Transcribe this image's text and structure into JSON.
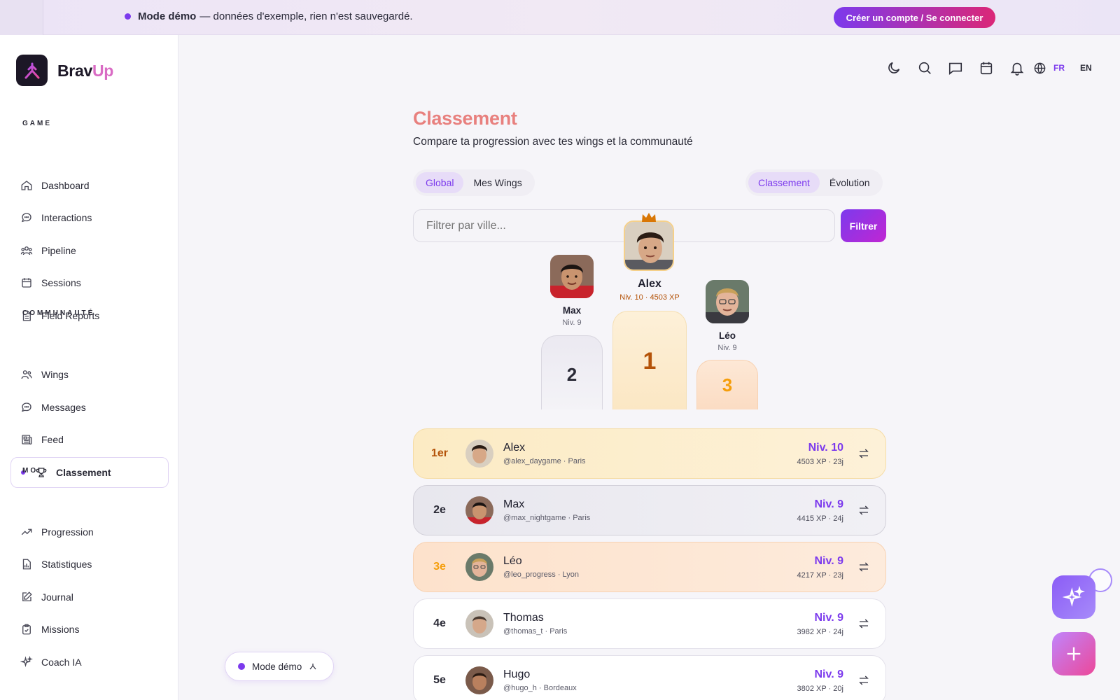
{
  "banner": {
    "mode_label": "Mode démo",
    "message": "— données d'exemple, rien n'est sauvegardé.",
    "cta_label": "Créer un compte / Se connecter"
  },
  "brand": {
    "name_part1": "Brav",
    "name_part2": "Up"
  },
  "sidebar": {
    "sections": [
      "GAME",
      "COMMUNAUTÉ",
      "MOI"
    ],
    "game_items": [
      {
        "label": "Dashboard",
        "icon": "home-icon"
      },
      {
        "label": "Interactions",
        "icon": "chat-bubble-icon"
      },
      {
        "label": "Pipeline",
        "icon": "users-icon"
      },
      {
        "label": "Sessions",
        "icon": "calendar-icon"
      },
      {
        "label": "Field Reports",
        "icon": "document-icon"
      }
    ],
    "community_items": [
      {
        "label": "Wings",
        "icon": "user-group-icon"
      },
      {
        "label": "Messages",
        "icon": "message-icon"
      },
      {
        "label": "Feed",
        "icon": "newspaper-icon"
      },
      {
        "label": "Classement",
        "icon": "trophy-icon",
        "active": true
      }
    ],
    "me_items": [
      {
        "label": "Progression",
        "icon": "trend-up-icon"
      },
      {
        "label": "Statistiques",
        "icon": "chart-file-icon"
      },
      {
        "label": "Journal",
        "icon": "edit-icon"
      },
      {
        "label": "Missions",
        "icon": "clipboard-icon"
      },
      {
        "label": "Coach IA",
        "icon": "sparkles-icon"
      }
    ]
  },
  "topbar": {
    "lang_fr": "FR",
    "lang_en": "EN",
    "active_lang": "FR"
  },
  "page": {
    "title": "Classement",
    "subtitle": "Compare ta progression avec tes wings et la communauté",
    "scope_tabs": [
      {
        "label": "Global",
        "active": true
      },
      {
        "label": "Mes Wings",
        "active": false
      }
    ],
    "view_tabs": [
      {
        "label": "Classement",
        "active": true
      },
      {
        "label": "Évolution",
        "active": false
      }
    ],
    "filter_placeholder": "Filtrer par ville...",
    "filter_button": "Filtrer"
  },
  "podium": {
    "first": {
      "name": "Alex",
      "meta": "Niv. 10 · 4503 XP",
      "rank": "1"
    },
    "second": {
      "name": "Max",
      "meta": "Niv. 9",
      "rank": "2"
    },
    "third": {
      "name": "Léo",
      "meta": "Niv. 9",
      "rank": "3"
    }
  },
  "leaderboard": [
    {
      "rank": "1er",
      "name": "Alex",
      "handle": "@alex_daygame · Paris",
      "level": "Niv. 10",
      "xp": "4503 XP · 23j"
    },
    {
      "rank": "2e",
      "name": "Max",
      "handle": "@max_nightgame · Paris",
      "level": "Niv. 9",
      "xp": "4415 XP · 24j"
    },
    {
      "rank": "3e",
      "name": "Léo",
      "handle": "@leo_progress · Lyon",
      "level": "Niv. 9",
      "xp": "4217 XP · 23j"
    },
    {
      "rank": "4e",
      "name": "Thomas",
      "handle": "@thomas_t · Paris",
      "level": "Niv. 9",
      "xp": "3982 XP · 24j"
    },
    {
      "rank": "5e",
      "name": "Hugo",
      "handle": "@hugo_h · Bordeaux",
      "level": "Niv. 9",
      "xp": "3802 XP · 20j"
    }
  ],
  "demo_pill": {
    "label": "Mode démo"
  },
  "colors": {
    "accent": "#7c3aed",
    "title": "#e8807e",
    "gold": "#b45309",
    "bronze": "#f59e0b"
  }
}
